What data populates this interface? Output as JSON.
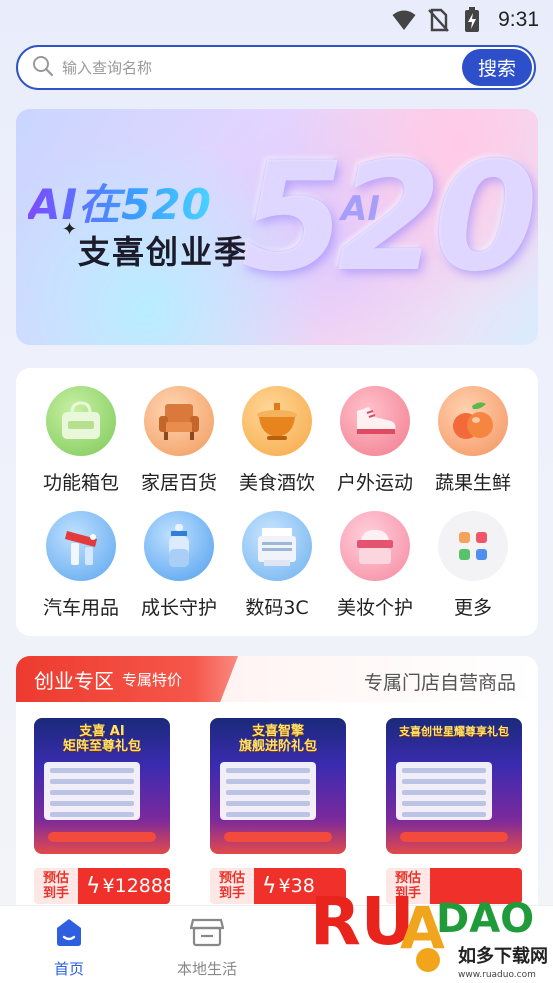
{
  "status_bar": {
    "time": "9:31",
    "icons": [
      "wifi-icon",
      "no-sim-icon",
      "battery-charging-icon"
    ]
  },
  "search": {
    "placeholder": "输入查询名称",
    "button_label": "搜索"
  },
  "banner": {
    "title_line1": "AI在520",
    "title_line2": "支喜创业季",
    "big_text": "520",
    "ai_text": "AI"
  },
  "categories": [
    {
      "label": "功能箱包",
      "icon": "bag-icon",
      "color": "#8fd46a"
    },
    {
      "label": "家居百货",
      "icon": "armchair-icon",
      "color": "#f2a066"
    },
    {
      "label": "美食酒饮",
      "icon": "hotpot-icon",
      "color": "#f7a84a"
    },
    {
      "label": "户外运动",
      "icon": "sneaker-icon",
      "color": "#f47d8a"
    },
    {
      "label": "蔬果生鲜",
      "icon": "peach-icon",
      "color": "#f38f5e"
    },
    {
      "label": "汽车用品",
      "icon": "car-wash-icon",
      "color": "#5fa6ef"
    },
    {
      "label": "成长守护",
      "icon": "baby-bottle-icon",
      "color": "#59a7f0"
    },
    {
      "label": "数码3C",
      "icon": "printer-icon",
      "color": "#6fb3ef"
    },
    {
      "label": "美妆个护",
      "icon": "cream-jar-icon",
      "color": "#f58aa4"
    },
    {
      "label": "更多",
      "icon": "more-grid-icon",
      "color": "#f2f2f4"
    }
  ],
  "section": {
    "title": "创业专区",
    "subtitle": "专属特价",
    "right_text": "专属门店自营商品",
    "products": [
      {
        "title": "支喜 AI\n矩阵至尊礼包",
        "price_label": "预估\n到手",
        "price": "¥12888"
      },
      {
        "title": "支喜智擎\n旗舰进阶礼包",
        "price_label": "预估\n到手",
        "price": "¥38"
      },
      {
        "title": "支喜创世星耀尊享礼包",
        "price_label": "预估\n到手",
        "price": ""
      }
    ]
  },
  "bottom_nav": {
    "items": [
      {
        "label": "首页",
        "icon": "home-icon",
        "active": true
      },
      {
        "label": "本地生活",
        "icon": "store-icon",
        "active": false
      }
    ],
    "active_color": "#2d5fe0",
    "inactive_color": "#888888"
  },
  "watermark": {
    "brand": "RUANDAO",
    "site": "如多下载网",
    "url": "www.ruaduo.com"
  }
}
